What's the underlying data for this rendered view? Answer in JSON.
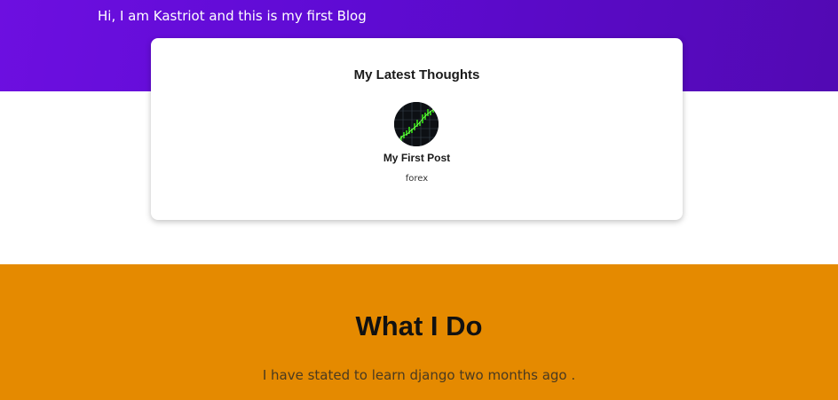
{
  "hero": {
    "text": "Hi, I am Kastriot and this is my first Blog"
  },
  "latest": {
    "title": "My Latest Thoughts",
    "posts": [
      {
        "title": "My First Post",
        "tag": "forex",
        "image_icon": "chart-thumbnail"
      }
    ]
  },
  "about": {
    "title": "What I Do",
    "text": "I have stated to learn django two months ago ."
  },
  "colors": {
    "hero_purple": "#6d0fe0",
    "section_orange": "#e58a00",
    "chart_green": "#39ff14"
  }
}
